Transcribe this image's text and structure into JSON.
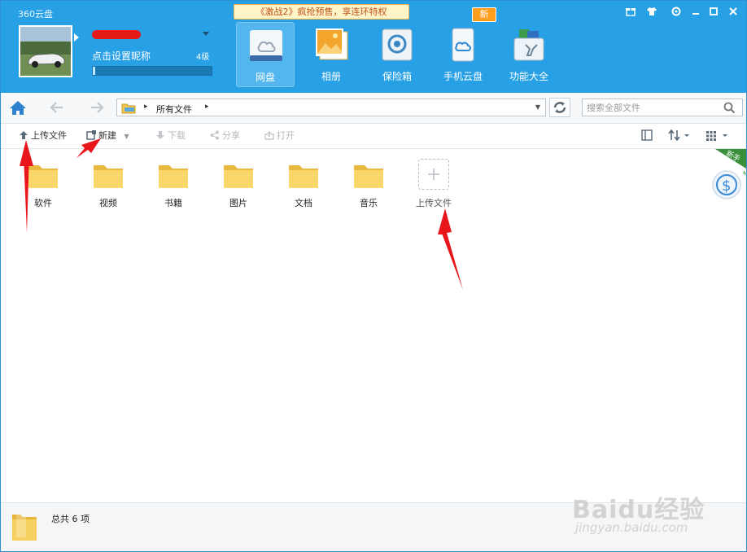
{
  "app": {
    "title": "360云盘"
  },
  "header": {
    "promo": "《激战2》疯抢预售，享连环特权",
    "user": {
      "nickname_hint": "点击设置昵称",
      "level": "4级",
      "quota_fraction": 0.02
    },
    "nav_tabs": [
      {
        "id": "netdisk",
        "label": "网盘",
        "icon": "cloud-drive-icon",
        "active": true
      },
      {
        "id": "album",
        "label": "相册",
        "icon": "photo-album-icon",
        "active": false
      },
      {
        "id": "safe",
        "label": "保险箱",
        "icon": "safe-box-icon",
        "active": false
      },
      {
        "id": "mobile",
        "label": "手机云盘",
        "icon": "mobile-cloud-icon",
        "active": false,
        "badge": "新"
      },
      {
        "id": "tools",
        "label": "功能大全",
        "icon": "toolbox-icon",
        "active": false
      }
    ],
    "window_controls": [
      "gift-icon",
      "skin-icon",
      "settings-icon",
      "minimize-icon",
      "maximize-icon",
      "close-icon"
    ]
  },
  "address": {
    "path": "所有文件",
    "search_placeholder": "搜索全部文件"
  },
  "toolbar": {
    "upload": "上传文件",
    "new": "新建",
    "download": "下载",
    "share": "分享",
    "open": "打开"
  },
  "files": [
    {
      "name": "软件"
    },
    {
      "name": "视频"
    },
    {
      "name": "书籍"
    },
    {
      "name": "图片"
    },
    {
      "name": "文档"
    },
    {
      "name": "音乐"
    }
  ],
  "upload_tile_label": "上传文件",
  "side_widget": {
    "ribbon": "新手",
    "symbol": "$"
  },
  "status": {
    "total": "总共 6 项"
  },
  "watermark": {
    "brand": "Baidu经验",
    "url": "jingyan.baidu.com"
  },
  "colors": {
    "header": "#27a0e6",
    "folder": "#f7cf5a",
    "annotation": "#e8151b"
  }
}
